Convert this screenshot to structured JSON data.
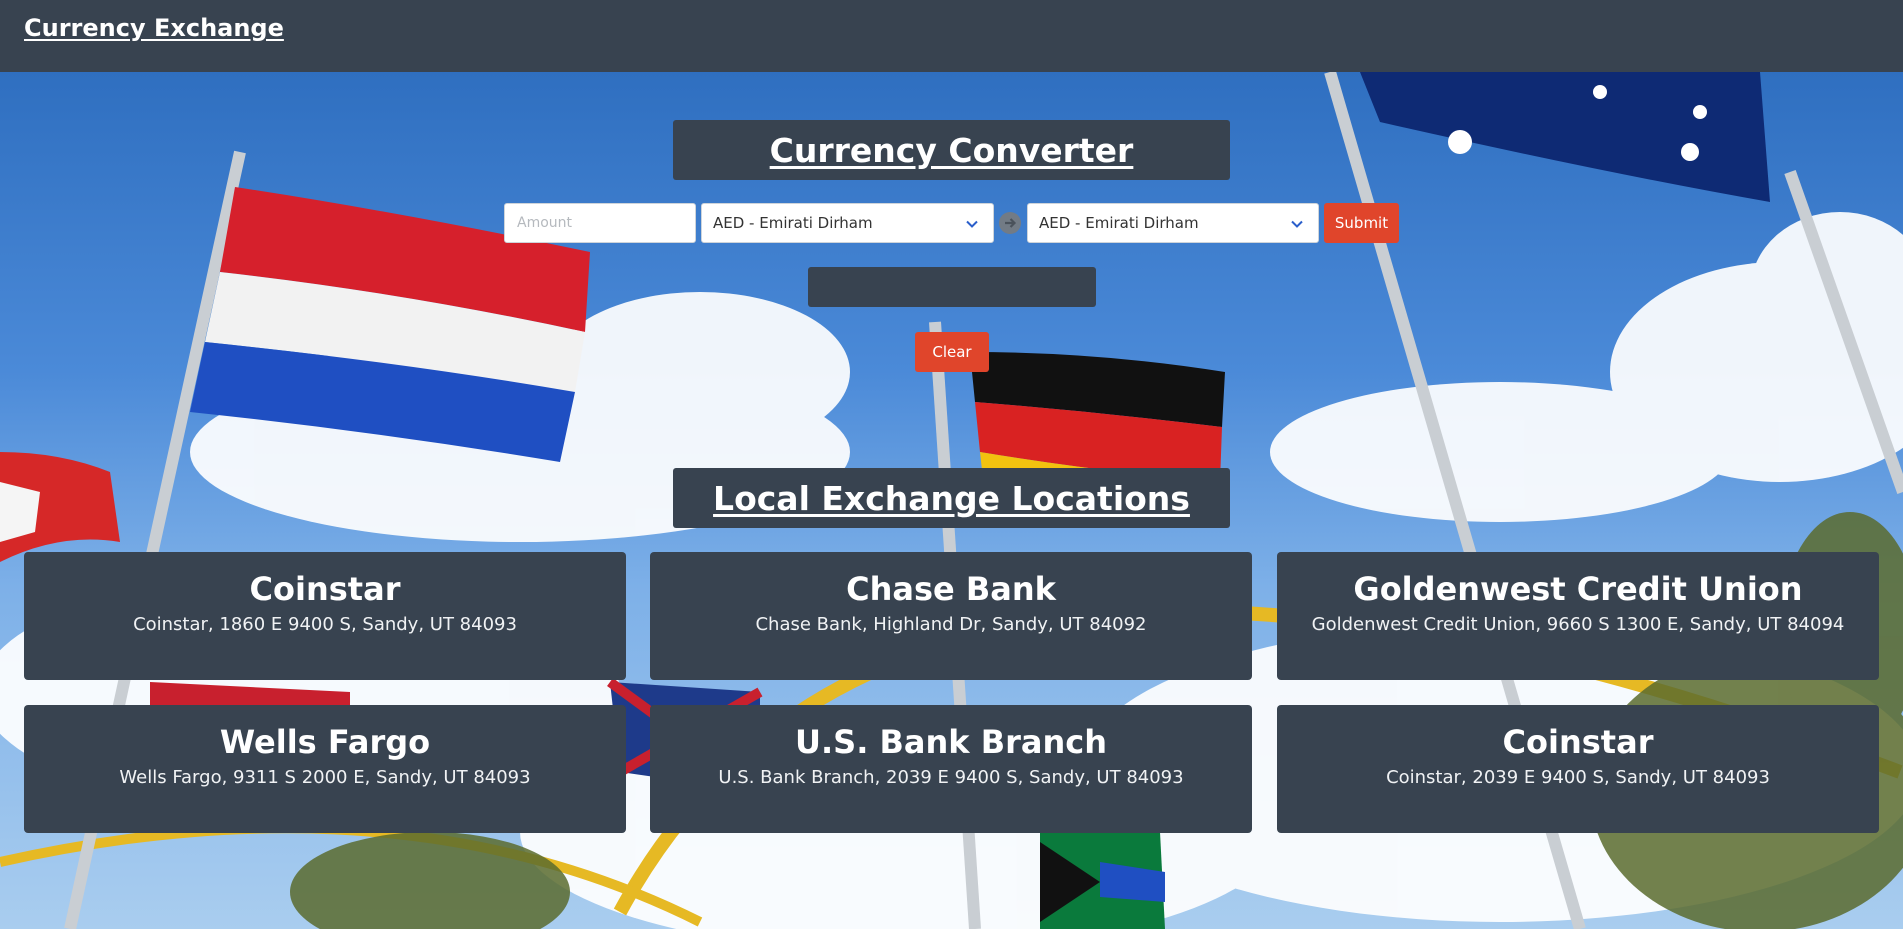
{
  "nav": {
    "brand": "Currency Exchange"
  },
  "converter": {
    "title": "Currency Converter",
    "amount_placeholder": "Amount",
    "amount_value": "",
    "from_currency": "AED - Emirati Dirham",
    "to_currency": "AED - Emirati Dirham",
    "submit_label": "Submit",
    "result": "",
    "clear_label": "Clear"
  },
  "locations": {
    "title": "Local Exchange Locations",
    "items": [
      {
        "name": "Coinstar",
        "address": "Coinstar, 1860 E 9400 S, Sandy, UT 84093"
      },
      {
        "name": "Chase Bank",
        "address": "Chase Bank, Highland Dr, Sandy, UT 84092"
      },
      {
        "name": "Goldenwest Credit Union",
        "address": "Goldenwest Credit Union, 9660 S 1300 E, Sandy, UT 84094"
      },
      {
        "name": "Wells Fargo",
        "address": "Wells Fargo, 9311 S 2000 E, Sandy, UT 84093"
      },
      {
        "name": "U.S. Bank Branch",
        "address": "U.S. Bank Branch, 2039 E 9400 S, Sandy, UT 84093"
      },
      {
        "name": "Coinstar",
        "address": "Coinstar, 2039 E 9400 S, Sandy, UT 84093"
      }
    ]
  },
  "colors": {
    "navbar": "#384350",
    "accent_red": "#e0452b",
    "panel": "#384350"
  },
  "icons": {
    "select_arrow": "chevron-down-icon",
    "swap": "arrow-right-circle-icon"
  }
}
